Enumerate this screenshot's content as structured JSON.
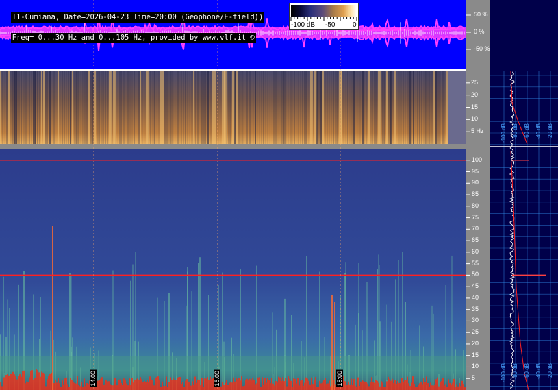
{
  "header": {
    "line1": "I1-Cumiana, Date=2026-04-23 Time=20:00 (Geophone/E-field))",
    "line2": "Freq= 0...30 Hz and 0...105 Hz, provided by www.vlf.it ©"
  },
  "colorbar": {
    "labels": [
      "-100 dB",
      "-50",
      "0"
    ],
    "colors": [
      "#000000",
      "#2a2f7a",
      "#a67a4a",
      "#ffe6b0",
      "#ffffff"
    ]
  },
  "colors": {
    "waveform_bg": "#0000ff",
    "waveform_trace": "#ff40ff",
    "waveform_peak": "#ffffff",
    "spectrogram_bg": "#2b3a86",
    "hum_line": "#ff2020",
    "right_panel_bg": "#00004a",
    "grid_line": "#3aa0ff"
  },
  "chart_data": [
    {
      "type": "line",
      "name": "waveform",
      "yticks": [
        "50 %",
        "0 %",
        "-50 %"
      ],
      "ylim": [
        -100,
        100
      ],
      "grid": true
    },
    {
      "type": "heatmap",
      "name": "spectrogram-0-30",
      "ylim": [
        0,
        30
      ],
      "yticks": [
        "25",
        "20",
        "15",
        "10",
        "5 Hz"
      ],
      "ytick_values": [
        25,
        20,
        15,
        10,
        5
      ]
    },
    {
      "type": "heatmap",
      "name": "spectrogram-0-105",
      "ylim": [
        0,
        105
      ],
      "yticks": [
        "100",
        "95",
        "90",
        "85",
        "80",
        "75",
        "70",
        "65",
        "60",
        "55",
        "50",
        "45",
        "40",
        "35",
        "30",
        "25",
        "20",
        "15",
        "10",
        "5"
      ],
      "ytick_values": [
        100,
        95,
        90,
        85,
        80,
        75,
        70,
        65,
        60,
        55,
        50,
        45,
        40,
        35,
        30,
        25,
        20,
        15,
        10,
        5
      ],
      "time_labels": [
        "14:00",
        "16:00",
        "18:00"
      ],
      "hum_lines_hz": [
        50,
        100
      ]
    },
    {
      "type": "line",
      "name": "spectrum-profile",
      "xticks": [
        "-100 dB",
        "-80 dB",
        "-60 dB",
        "-40 dB",
        "-20 dB"
      ],
      "xtick_values": [
        -100,
        -80,
        -60,
        -40,
        -20
      ],
      "peaks_hz": [
        50,
        100
      ]
    }
  ]
}
